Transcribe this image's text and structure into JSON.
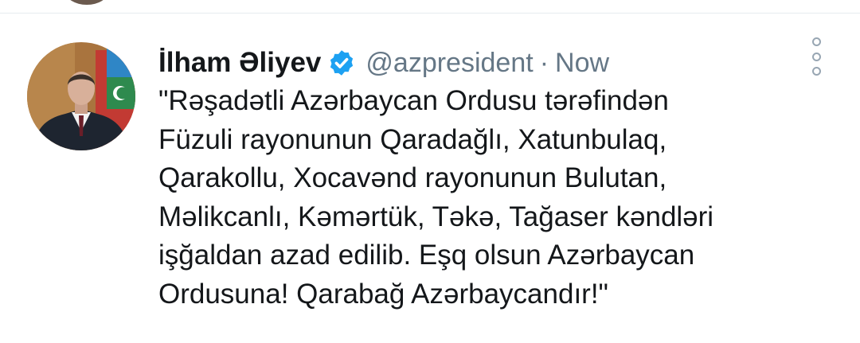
{
  "tweet": {
    "author_name": "İlham Əliyev",
    "handle": "@azpresident",
    "separator": "·",
    "time": "Now",
    "text_lines": [
      "\"Rəşadətli Azərbaycan Ordusu tərəfindən",
      "Füzuli rayonunun Qaradağlı, Xatunbulaq,",
      "Qarakollu, Xocavənd rayonunun Bulutan,",
      "Məlikcanlı, Kəmərtük, Təkə, Tağaser kəndləri",
      "işğaldan azad edilib. Eşq olsun Azərbaycan",
      "Ordusuna! Qarabağ Azərbaycandır!\""
    ]
  },
  "icons": {
    "verified": "verified-badge-icon",
    "more": "more-options-icon"
  },
  "colors": {
    "verified_blue": "#1da1f2",
    "text": "#14171a",
    "secondary": "#657786",
    "divider": "#e6ecf0"
  }
}
